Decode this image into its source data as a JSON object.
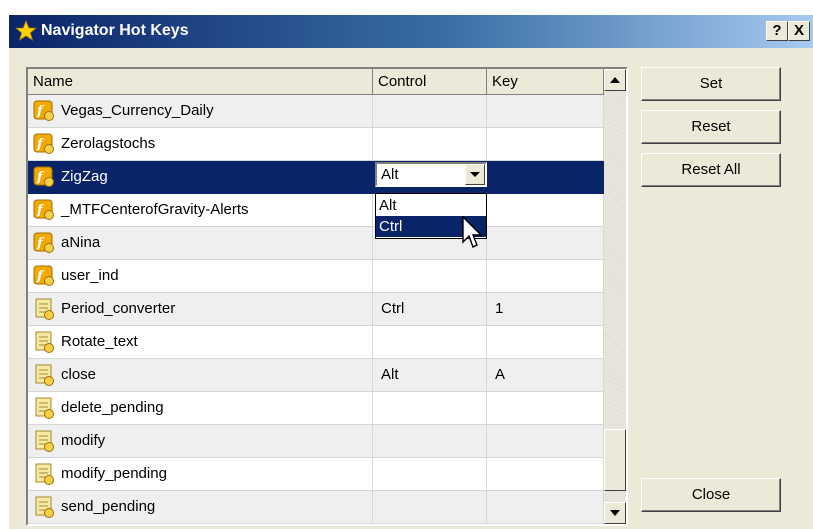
{
  "window": {
    "title": "Navigator Hot Keys",
    "help_label": "?",
    "close_label": "X"
  },
  "table": {
    "columns": [
      "Name",
      "Control",
      "Key"
    ],
    "rows": [
      {
        "name": "Vegas_Currency_Daily",
        "control": "",
        "key": "",
        "icon": "custom-indicator-icon"
      },
      {
        "name": "Zerolagstochs",
        "control": "",
        "key": "",
        "icon": "custom-indicator-icon"
      },
      {
        "name": "ZigZag",
        "control": "",
        "key": "",
        "icon": "custom-indicator-icon",
        "selected": true
      },
      {
        "name": "_MTFCenterofGravity-Alerts",
        "control": "",
        "key": "",
        "icon": "custom-indicator-icon"
      },
      {
        "name": "aNina",
        "control": "",
        "key": "",
        "icon": "custom-indicator-icon"
      },
      {
        "name": "user_ind",
        "control": "",
        "key": "",
        "icon": "custom-indicator-icon"
      },
      {
        "name": "Period_converter",
        "control": "Ctrl",
        "key": "1",
        "icon": "script-icon"
      },
      {
        "name": "Rotate_text",
        "control": "",
        "key": "",
        "icon": "script-icon"
      },
      {
        "name": "close",
        "control": "Alt",
        "key": "A",
        "icon": "script-icon"
      },
      {
        "name": "delete_pending",
        "control": "",
        "key": "",
        "icon": "script-icon"
      },
      {
        "name": "modify",
        "control": "",
        "key": "",
        "icon": "script-icon"
      },
      {
        "name": "modify_pending",
        "control": "",
        "key": "",
        "icon": "script-icon"
      },
      {
        "name": "send_pending",
        "control": "",
        "key": "",
        "icon": "script-icon"
      }
    ]
  },
  "combo": {
    "value": "Alt",
    "options": [
      "Alt",
      "Ctrl"
    ],
    "highlighted": "Ctrl"
  },
  "buttons": {
    "set": "Set",
    "reset": "Reset",
    "reset_all": "Reset All",
    "close": "Close"
  },
  "colors": {
    "selection": "#0a246a",
    "face": "#ece9d8",
    "row_alt": "#efefef",
    "indicator_icon": "#f2a900"
  }
}
